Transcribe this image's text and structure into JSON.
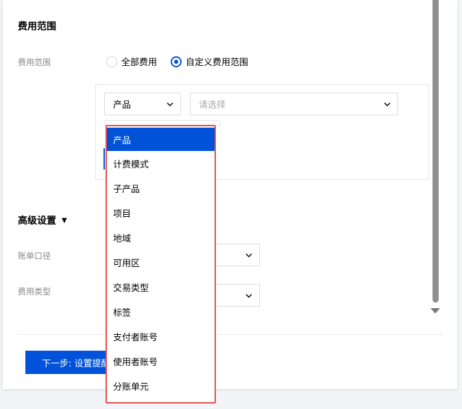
{
  "cost_scope": {
    "section_title": "费用范围",
    "label": "费用范围",
    "options": [
      {
        "label": "全部费用",
        "checked": false
      },
      {
        "label": "自定义费用范围",
        "checked": true
      }
    ],
    "dimension_select": {
      "value": "产品"
    },
    "value_select": {
      "placeholder": "请选择"
    }
  },
  "dropdown": {
    "items": [
      "产品",
      "计费模式",
      "子产品",
      "项目",
      "地域",
      "可用区",
      "交易类型",
      "标签",
      "支付者账号",
      "使用者账号",
      "分账单元"
    ],
    "selected_index": 0
  },
  "advanced": {
    "title": "高级设置",
    "toggle_icon": "▼",
    "bill_caliber_label": "账单口径",
    "cost_type_label": "费用类型"
  },
  "footer": {
    "next_button": "下一步: 设置提醒"
  },
  "colors": {
    "accent": "#0052d9",
    "highlight_border": "#e34d4d"
  }
}
